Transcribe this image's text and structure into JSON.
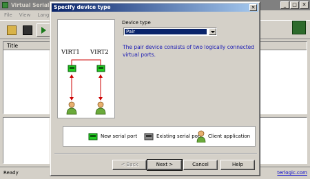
{
  "main_window": {
    "title": "Virtual Serial Po",
    "menu": [
      "File",
      "View",
      "Langu"
    ],
    "list_header": "Title",
    "status_text": "Ready",
    "status_link": "terlogic.com"
  },
  "dialog": {
    "title": "Specify device type",
    "close_glyph": "✕",
    "device_type_label": "Device type",
    "device_type_value": "Pair",
    "description": "The pair device consists of two logically connected virtual ports.",
    "diagram": {
      "port1_label": "VIRT1",
      "port2_label": "VIRT2"
    },
    "legend": {
      "new_port": "New serial port",
      "existing_port": "Existing serial port",
      "client_app": "Client application"
    },
    "buttons": {
      "back": "< Back",
      "next": "Next >",
      "cancel": "Cancel",
      "help": "Help"
    }
  },
  "colors": {
    "accent": "#0a246a",
    "description_text": "#1b1bb4",
    "new_port": "#22cc22",
    "link_arrow": "#cc0000"
  },
  "icons": [
    "open-folder-icon",
    "save-icon",
    "run-icon",
    "new-port-icon",
    "existing-port-icon",
    "client-app-icon",
    "chevron-down-icon",
    "close-icon"
  ]
}
